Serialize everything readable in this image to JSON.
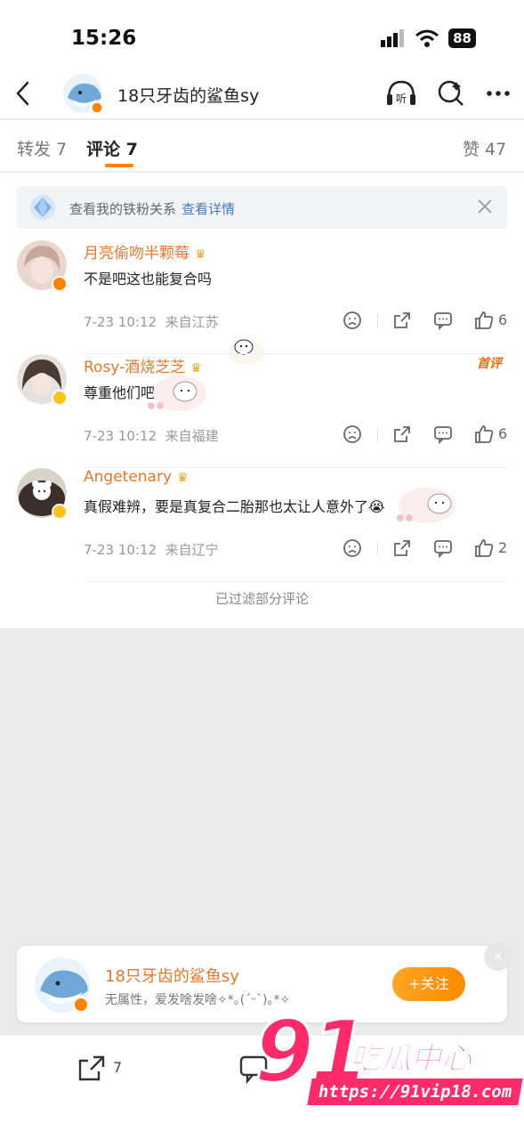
{
  "status_bar": {
    "time": "15:26",
    "battery": "88"
  },
  "nav": {
    "title": "18只牙齿的鲨鱼sy",
    "listen_label": "听"
  },
  "tabs": {
    "repost": "转发 7",
    "comments": "评论 7",
    "likes": "赞 47"
  },
  "fans_banner": {
    "text": "查看我的铁粉关系",
    "link": "查看详情"
  },
  "comments": [
    {
      "name": "月亮偷吻半颗莓",
      "text": "不是吧这也能复合吗",
      "time": "7-23 10:12",
      "location": "来自江苏",
      "likes": "6",
      "author_tag": ""
    },
    {
      "name": "Rosy-酒烧芝芝",
      "text": "尊重他们吧",
      "time": "7-23 10:12",
      "location": "来自福建",
      "likes": "6",
      "author_tag": "首评"
    },
    {
      "name": "Angetenary",
      "text": "真假难辨，要是真复合二胎那也太让人意外了😭",
      "time": "7-23 10:12",
      "location": "来自辽宁",
      "likes": "2",
      "author_tag": ""
    }
  ],
  "filtered_note": "已过滤部分评论",
  "follow_card": {
    "name": "18只牙齿的鲨鱼sy",
    "bio": "无属性，爱发啥发啥✧*｡(ˊᵕˋ)｡*✧",
    "follow_label": "+关注",
    "close": "×"
  },
  "bottom_bar": {
    "share_count": "7"
  },
  "watermark": {
    "number": "91",
    "text": "吃瓜中心",
    "url": "https://91vip18.com"
  },
  "colors": {
    "accent": "#ff8200",
    "name": "#e8772e",
    "link": "#4a78b5",
    "watermark": "#ff2a6a"
  }
}
